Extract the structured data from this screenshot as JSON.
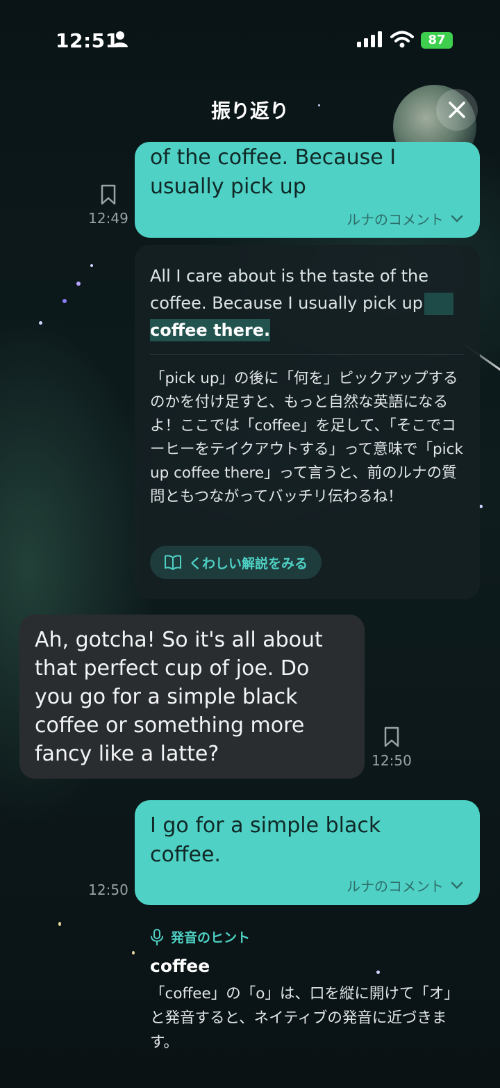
{
  "status_bar": {
    "time": "12:51",
    "battery": "87"
  },
  "header": {
    "title": "振り返り"
  },
  "messages": [
    {
      "role": "user",
      "text": "of the coffee. Because I usually pick up",
      "time": "12:49",
      "comment_label": "ルナのコメント"
    },
    {
      "role": "ai",
      "text": "Ah, gotcha! So it's all about that perfect cup of joe. Do you go for a simple black coffee or something more fancy like a latte?",
      "time": "12:50"
    },
    {
      "role": "user",
      "text": "I go for a simple black coffee.",
      "time": "12:50",
      "comment_label": "ルナのコメント"
    }
  ],
  "feedback": {
    "corrected_prefix": "All I care about is the taste of the coffee. Because I usually pick up",
    "corrected_addition": "coffee there.",
    "explanation": "「pick up」の後に「何を」ピックアップするのかを付け足すと、もっと自然な英語になるよ！ここでは「coffee」を足して、「そこでコーヒーをテイクアウトする」って意味で「pick up coffee there」って言うと、前のルナの質問ともつながってバッチリ伝わるね！",
    "detail_button": "くわしい解説をみる"
  },
  "pronunciation_hint": {
    "label": "発音のヒント",
    "word": "coffee",
    "body": "「coffee」の「o」は、口を縦に開けて「オ」と発音すると、ネイティブの発音に近づきます。"
  },
  "colors": {
    "accent": "#4fd1c5",
    "ai_bubble": "#2a2d30",
    "background": "#0b1518"
  },
  "icons": [
    "person-icon",
    "signal-icon",
    "wifi-icon",
    "close-icon",
    "bookmark-icon",
    "book-icon",
    "chevron-down-icon",
    "microphone-icon"
  ]
}
